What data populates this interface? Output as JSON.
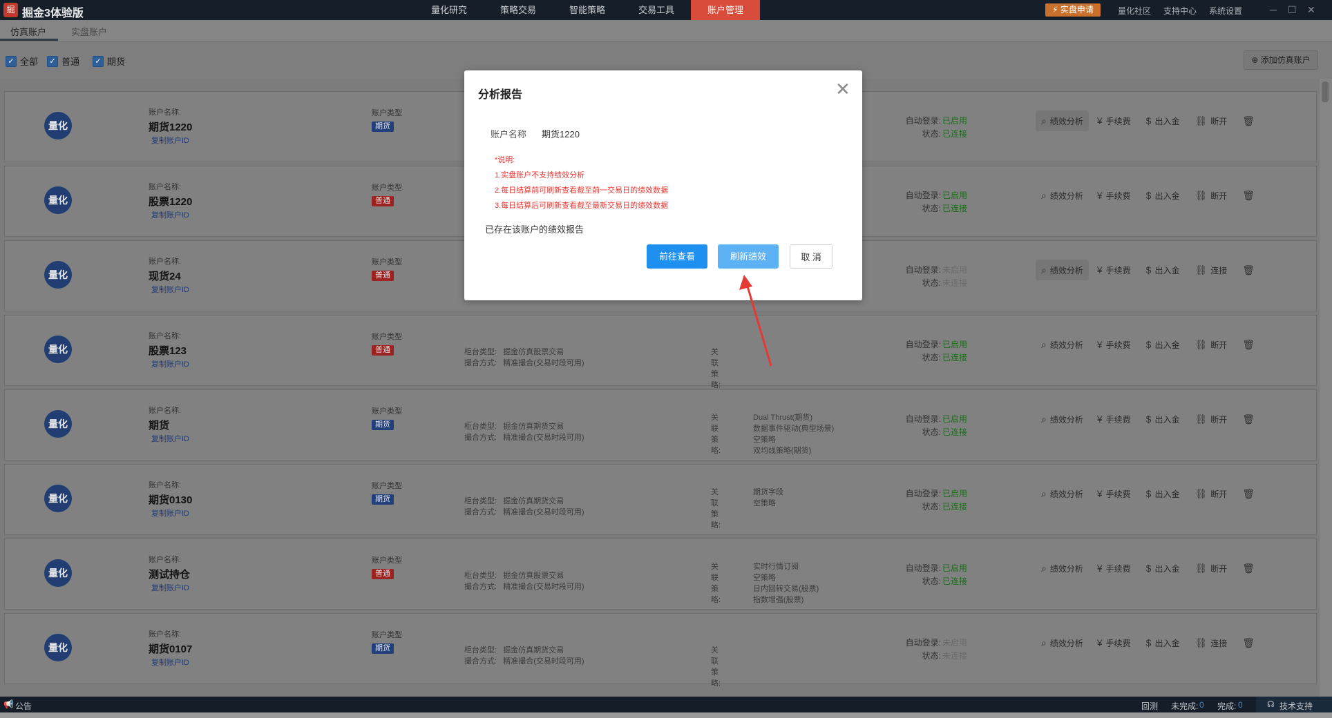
{
  "app": {
    "logo_text": "掘",
    "title": "掘金3体验版",
    "nav": [
      "量化研究",
      "策略交易",
      "智能策略",
      "交易工具",
      "账户管理"
    ],
    "nav_active_index": 4,
    "apply_button": "⚡ 实盘申请",
    "links": [
      "量化社区",
      "支持中心",
      "系统设置"
    ]
  },
  "tabs": [
    "仿真账户",
    "实盘账户"
  ],
  "filters": [
    "全部",
    "普通",
    "期货"
  ],
  "add_button": "添加仿真账户",
  "labels": {
    "account_name": "账户名称:",
    "account_type": "账户类型",
    "copy_id": "复制账户ID",
    "counter_type": "柜台类型:",
    "match_mode": "撮合方式:",
    "strategy": "关联策略:",
    "auto_login": "自动登录:",
    "status": "状态:",
    "avatar": "量化"
  },
  "actions": {
    "perf": "绩效分析",
    "fee": "手续费",
    "cash": "出入金",
    "disconnect": "断开",
    "connect": "连接"
  },
  "accounts": [
    {
      "name": "期货1220",
      "type": "期货",
      "type_kind": "fut",
      "counter": "",
      "match": "",
      "strategies": [],
      "auto_login": "已启用",
      "status": "已连接",
      "connected": true
    },
    {
      "name": "股票1220",
      "type": "普通",
      "type_kind": "gen",
      "counter": "",
      "match": "",
      "strategies": [],
      "auto_login": "已启用",
      "status": "已连接",
      "connected": true
    },
    {
      "name": "现货24",
      "type": "普通",
      "type_kind": "gen",
      "counter": "",
      "match": "",
      "strategies": [],
      "auto_login": "未启用",
      "status": "未连接",
      "connected": false
    },
    {
      "name": "股票123",
      "type": "普通",
      "type_kind": "gen",
      "counter": "掘金仿真股票交易",
      "match": "精准撮合(交易时段可用)",
      "strategies": [],
      "auto_login": "已启用",
      "status": "已连接",
      "connected": true
    },
    {
      "name": "期货",
      "type": "期货",
      "type_kind": "fut",
      "counter": "掘金仿真期货交易",
      "match": "精准撮合(交易时段可用)",
      "strategies": [
        "Dual Thrust(期货)",
        "数据事件驱动(典型场景)",
        "空策略",
        "双均线策略(期货)"
      ],
      "auto_login": "已启用",
      "status": "已连接",
      "connected": true
    },
    {
      "name": "期货0130",
      "type": "期货",
      "type_kind": "fut",
      "counter": "掘金仿真期货交易",
      "match": "精准撮合(交易时段可用)",
      "strategies": [
        "期货字段",
        "空策略"
      ],
      "auto_login": "已启用",
      "status": "已连接",
      "connected": true
    },
    {
      "name": "测试持仓",
      "type": "普通",
      "type_kind": "gen",
      "counter": "掘金仿真股票交易",
      "match": "精准撮合(交易时段可用)",
      "strategies": [
        "实时行情订阅",
        "空策略",
        "日内回转交易(股票)",
        "指数增强(股票)"
      ],
      "auto_login": "已启用",
      "status": "已连接",
      "connected": true
    },
    {
      "name": "期货0107",
      "type": "期货",
      "type_kind": "fut",
      "counter": "掘金仿真期货交易",
      "match": "精准撮合(交易时段可用)",
      "strategies": [],
      "auto_login": "未启用",
      "status": "未连接",
      "connected": false
    }
  ],
  "status_bar": {
    "notice": "公告",
    "backtest": "回测",
    "unfinished_label": "未完成:",
    "unfinished_value": "0",
    "finished_label": "完成:",
    "finished_value": "0",
    "support": "技术支持"
  },
  "modal": {
    "title": "分析报告",
    "close": "✕",
    "account_label": "账户名称",
    "account_value": "期货1220",
    "notes": [
      "*说明:",
      "1.实盘账户不支持绩效分析",
      "2.每日结算前可刷新查看截至前一交易日的绩效数据",
      "3.每日结算后可刷新查看截至最新交易日的绩效数据"
    ],
    "exists_text": "已存在该账户的绩效报告",
    "btn_view": "前往查看",
    "btn_refresh": "刷新绩效",
    "btn_cancel": "取 消"
  },
  "colors": {
    "titlebar": "#151e29",
    "nav_active": "#d94b3b",
    "primary": "#1f8ff0",
    "note_red": "#e53935",
    "arrow": "#e53935"
  }
}
